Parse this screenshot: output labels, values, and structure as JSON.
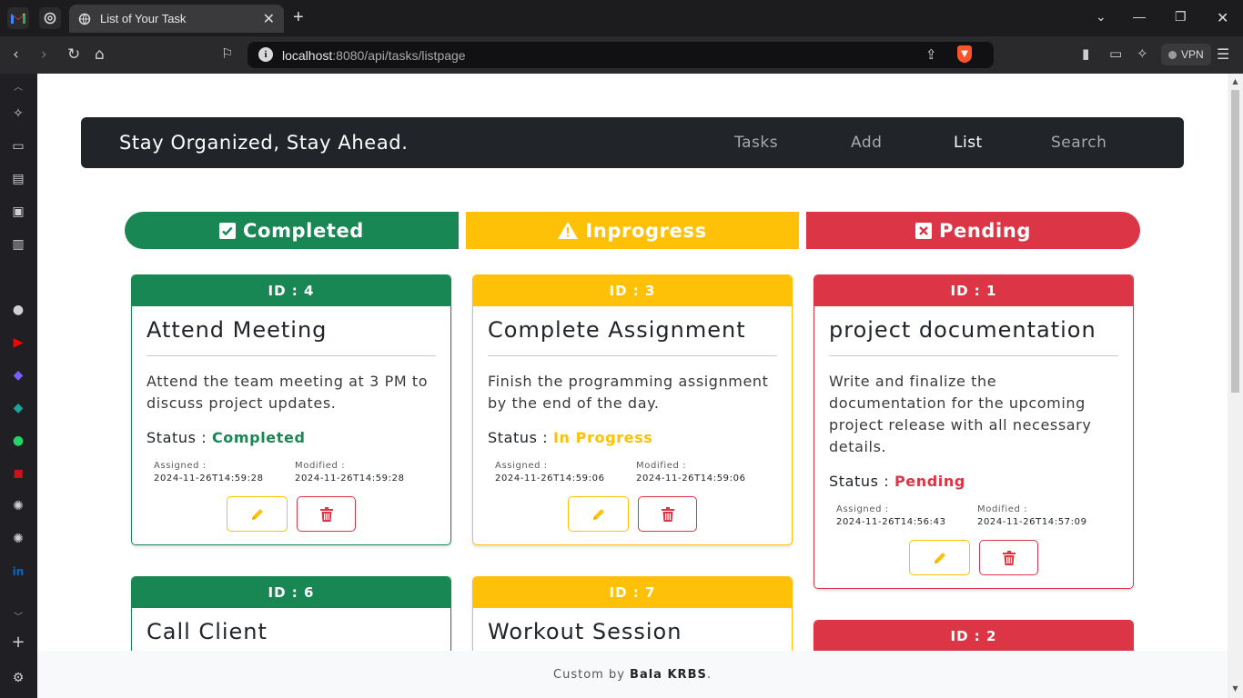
{
  "browser": {
    "tab_title": "List of Your Task",
    "url_host": "localhost",
    "url_rest": ":8080/api/tasks/listpage",
    "vpn_label": "VPN",
    "colors": {
      "chrome_bg": "#1c1c1e",
      "toolbar_bg": "#2a2a2d",
      "urlbar_bg": "#111113"
    }
  },
  "navbar": {
    "brand": "Stay Organized, Stay Ahead.",
    "links": [
      {
        "label": "Tasks",
        "active": false
      },
      {
        "label": "Add",
        "active": false
      },
      {
        "label": "List",
        "active": true
      },
      {
        "label": "Search",
        "active": false
      }
    ]
  },
  "columns": [
    {
      "label": "Completed",
      "icon": "check-square-icon",
      "color": "#198754"
    },
    {
      "label": "Inprogress",
      "icon": "warning-triangle-icon",
      "color": "#ffc107"
    },
    {
      "label": "Pending",
      "icon": "x-square-icon",
      "color": "#dc3545"
    }
  ],
  "tasks": [
    {
      "id_label": "ID : 4",
      "title": "Attend Meeting",
      "description": "Attend the team meeting at 3 PM to discuss project updates.",
      "status_label": "Status : ",
      "status": "Completed",
      "assigned_label": "Assigned :",
      "assigned": "2024-11-26T14:59:28",
      "modified_label": "Modified :",
      "modified": "2024-11-26T14:59:28"
    },
    {
      "id_label": "ID : 3",
      "title": "Complete Assignment",
      "description": "Finish the programming assignment by the end of the day.",
      "status_label": "Status : ",
      "status": "In Progress",
      "assigned_label": "Assigned :",
      "assigned": "2024-11-26T14:59:06",
      "modified_label": "Modified :",
      "modified": "2024-11-26T14:59:06"
    },
    {
      "id_label": "ID : 1",
      "title": "project documentation",
      "description": "Write and finalize the documentation for the upcoming project release with all necessary details.",
      "status_label": "Status : ",
      "status": "Pending",
      "assigned_label": "Assigned :",
      "assigned": "2024-11-26T14:56:43",
      "modified_label": "Modified :",
      "modified": "2024-11-26T14:57:09"
    },
    {
      "id_label": "ID : 6",
      "title": "Call Client"
    },
    {
      "id_label": "ID : 7",
      "title": "Workout Session"
    },
    {
      "id_label": "ID : 2"
    }
  ],
  "footer": {
    "prefix": "Custom by ",
    "author": "Bala KRBS",
    "suffix": "."
  }
}
